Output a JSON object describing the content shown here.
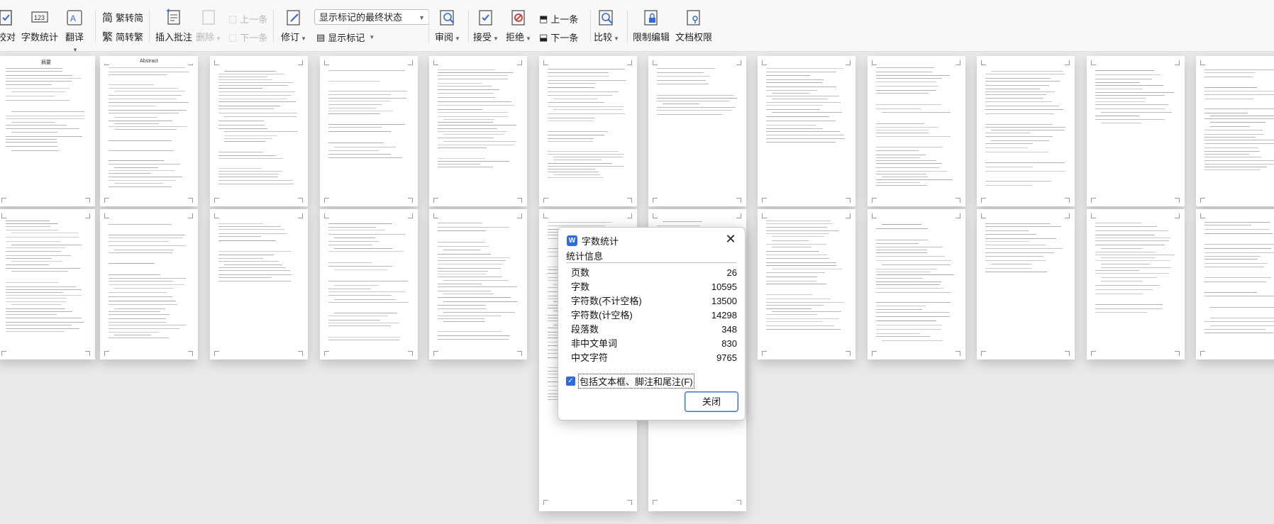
{
  "toolbar": {
    "proofread": "校对",
    "word_count": "字数统计",
    "translate": "翻译",
    "trad_to_simp": "繁转简",
    "simp_to_trad": "简转繁",
    "insert_comment": "插入批注",
    "delete": "删除",
    "prev_comment": "上一条",
    "next_comment": "下一条",
    "revise": "修订",
    "markup_select": "显示标记的最终状态",
    "show_markup": "显示标记",
    "review": "审阅",
    "accept": "接受",
    "reject": "拒绝",
    "prev_change": "上一条",
    "next_change": "下一条",
    "compare": "比较",
    "restrict_edit": "限制编辑",
    "doc_permission": "文档权限"
  },
  "dialog": {
    "title": "字数统计",
    "section": "统计信息",
    "stats": [
      {
        "label": "页数",
        "value": "26"
      },
      {
        "label": "字数",
        "value": "10595"
      },
      {
        "label": "字符数(不计空格)",
        "value": "13500"
      },
      {
        "label": "字符数(计空格)",
        "value": "14298"
      },
      {
        "label": "段落数",
        "value": "348"
      },
      {
        "label": "非中文单词",
        "value": "830"
      },
      {
        "label": "中文字符",
        "value": "9765"
      }
    ],
    "include_label": "包括文本框、脚注和尾注(F)",
    "close_button": "关闭"
  },
  "pages": {
    "p1_title": "摘要",
    "p2_title": "Abstract"
  },
  "colors": {
    "accent": "#2d6be0"
  }
}
